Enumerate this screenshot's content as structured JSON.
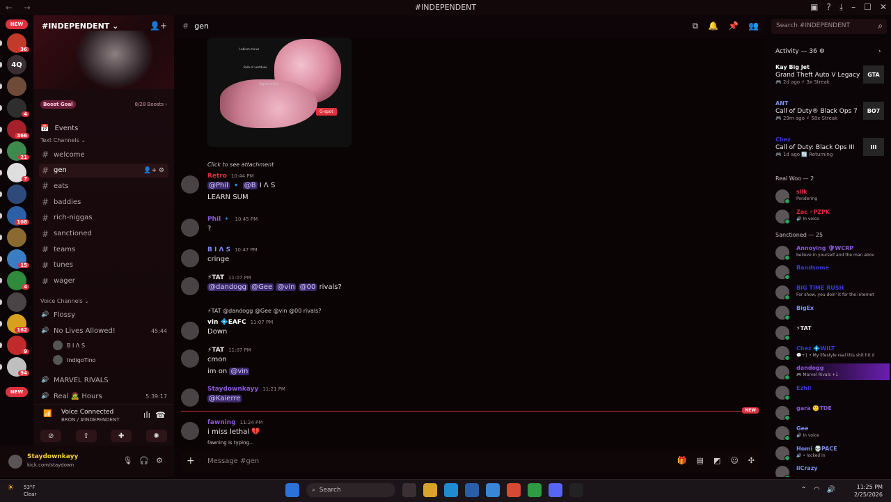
{
  "window": {
    "title": "#INDEPENDENT",
    "controls": [
      "–",
      "☐",
      "✕"
    ]
  },
  "rail": {
    "new_top": "NEW",
    "new_bottom": "NEW",
    "servers": [
      {
        "label": "",
        "badge": "36",
        "color": "#c23b2a"
      },
      {
        "label": "4Q",
        "badge": "",
        "color": "#3a3034"
      },
      {
        "label": "",
        "badge": "",
        "color": "#6d4b38"
      },
      {
        "label": "",
        "badge": "4",
        "color": "#2e2e2e"
      },
      {
        "label": "",
        "badge": "366",
        "color": "#a5202a"
      },
      {
        "label": "",
        "badge": "21",
        "color": "#3d8a4f"
      },
      {
        "label": "",
        "badge": "7",
        "color": "#dedede"
      },
      {
        "label": "",
        "badge": "",
        "color": "#2d4a7a"
      },
      {
        "label": "",
        "badge": "108",
        "color": "#2c5fa6"
      },
      {
        "label": "",
        "badge": "",
        "color": "#8a6a30"
      },
      {
        "label": "",
        "badge": "15",
        "color": "#3a7dc2"
      },
      {
        "label": "",
        "badge": "4",
        "color": "#2f8a3b"
      },
      {
        "label": "",
        "badge": "",
        "color": "#4a4446"
      },
      {
        "label": "",
        "badge": "162",
        "color": "#d7a11e"
      },
      {
        "label": "",
        "badge": "9",
        "color": "#c12a2a"
      },
      {
        "label": "",
        "badge": "94",
        "color": "#bfbfbf"
      }
    ]
  },
  "server": {
    "name": "#INDEPENDENT ⌄",
    "boost_goal": "Boost Goal",
    "boost_count": "8/28 Boosts ›",
    "events": "Events"
  },
  "text_category": "Text Channels ⌄",
  "channels": [
    "welcome",
    "gen",
    "eats",
    "baddies",
    "rich-niggas",
    "sanctioned",
    "teams",
    "tunes",
    "wager"
  ],
  "voice_category": "Voice Channels ⌄",
  "voice_channels": [
    {
      "name": "Flossy",
      "time": ""
    },
    {
      "name": "No Lives Allowed!",
      "time": "45:44"
    },
    {
      "name": "MARVEL RIVALS",
      "time": ""
    },
    {
      "name": "Real 🧟 Hours",
      "time": "5:39:17"
    }
  ],
  "voice_users": [
    "B I Λ S",
    "IndigoTino"
  ],
  "voice_panel": {
    "status": "Voice Connected",
    "sub": "BRON / #INDEPENDENT"
  },
  "user": {
    "name": "Staydownkayy",
    "status": "kick.com/staydown"
  },
  "chat_header": {
    "title": "gen"
  },
  "search_placeholder": "Search #INDEPENDENT",
  "image": {
    "gspot": "G-spot",
    "labels": [
      "Labium minus",
      "Bulb of vestibule",
      "Vaginal orifice"
    ]
  },
  "messages": [
    {
      "reply": "Click to see attachment",
      "author": "Retro",
      "color": "#e0323e",
      "time": "10:44 PM",
      "lines": [
        "@Phil 🔹 @B I Λ S",
        "LEARN SUM"
      ]
    },
    {
      "reply": "",
      "author": "Phil 🔹",
      "color": "#8a5ad8",
      "time": "10:45 PM",
      "lines": [
        "?"
      ]
    },
    {
      "reply": "",
      "author": "B I Λ S",
      "color": "#7f8ef2",
      "time": "10:47 PM",
      "lines": [
        "cringe"
      ]
    },
    {
      "reply": "",
      "author": "⚡TAT",
      "color": "#e9e1e4",
      "time": "11:07 PM",
      "lines": [
        "@dandogg @Gee @vin @00 rivals?"
      ]
    },
    {
      "reply": "⚡TAT @dandogg @Gee @vin @00 rivals?",
      "author": "vin 💠EAFC",
      "color": "#ffffff",
      "time": "11:07 PM",
      "lines": [
        "Down"
      ]
    },
    {
      "reply": "",
      "author": "⚡TAT",
      "color": "#e9e1e4",
      "time": "11:07 PM",
      "lines": [
        "cmon",
        "im on @vin"
      ]
    },
    {
      "reply": "",
      "author": "Staydownkayy",
      "color": "#8a5ad8",
      "time": "11:21 PM",
      "lines": [
        "@Kaierre"
      ]
    },
    {
      "reply": "",
      "author": "fawning",
      "color": "#8a5ad8",
      "time": "11:24 PM",
      "lines": [
        "i miss lethal 💔"
      ]
    }
  ],
  "new_label": "NEW",
  "typing": "fawning is typing...",
  "composer_placeholder": "Message #gen",
  "activity": {
    "header": "Activity — 36 ⚙",
    "items": [
      {
        "user": "Kay Big Jet",
        "color": "#ffffff",
        "game": "Grand Theft Auto V Legacy",
        "meta": "🎮 2d ago ⚡ 3x Streak",
        "art": "GTA"
      },
      {
        "user": "ANT",
        "color": "#7f8ef2",
        "game": "Call of Duty® Black Ops 7",
        "meta": "🎮 29m ago ⚡ 58x Streak",
        "art": "BO7"
      },
      {
        "user": "Chez",
        "color": "#3a3ad8",
        "game": "Call of Duty: Black Ops III",
        "meta": "🎮 1d ago 🔄 Returning",
        "art": "III"
      }
    ]
  },
  "groups": [
    {
      "name": "Real Woo — 2",
      "members": [
        {
          "name": "silk",
          "color": "#e0323e",
          "status": "Pondering"
        },
        {
          "name": "Zac ⚡PZPK",
          "color": "#e0323e",
          "status": "🔊 In voice"
        }
      ]
    },
    {
      "name": "Sanctioned — 25",
      "members": [
        {
          "name": "Annoying 🛡WCRP",
          "color": "#8a5ad8",
          "status": "believe in yourself and the man abov"
        },
        {
          "name": "Bandsome",
          "color": "#3a3ad8",
          "status": ""
        },
        {
          "name": "BIG TIME RUSH",
          "color": "#3a3ad8",
          "status": "For show, you doin' it for the internet"
        },
        {
          "name": "BigEx",
          "color": "#7f8ef2",
          "status": ""
        },
        {
          "name": "⚡TAT",
          "color": "#e9e1e4",
          "status": ""
        },
        {
          "name": "Chez 💠WILT",
          "color": "#3a3ad8",
          "status": "💬+1 • My lifestyle real this shit hit d"
        },
        {
          "name": "dandogg",
          "color": "#8a5ad8",
          "status": "🎮 Marvel Rivals +1"
        },
        {
          "name": "Ezhil",
          "color": "#3a3ad8",
          "status": ""
        },
        {
          "name": "gara 🙂TDE",
          "color": "#8a5ad8",
          "status": ""
        },
        {
          "name": "Gee",
          "color": "#7f8ef2",
          "status": "🔊 In voice"
        },
        {
          "name": "Homi 💀PACE",
          "color": "#7f8ef2",
          "status": "🔊 • locked in"
        },
        {
          "name": "iiCrazy",
          "color": "#7f8ef2",
          "status": ""
        }
      ]
    }
  ],
  "taskbar": {
    "temp": "53°F",
    "weather": "Clear",
    "search": "Search",
    "time": "11:25 PM",
    "date": "2/25/2026"
  }
}
